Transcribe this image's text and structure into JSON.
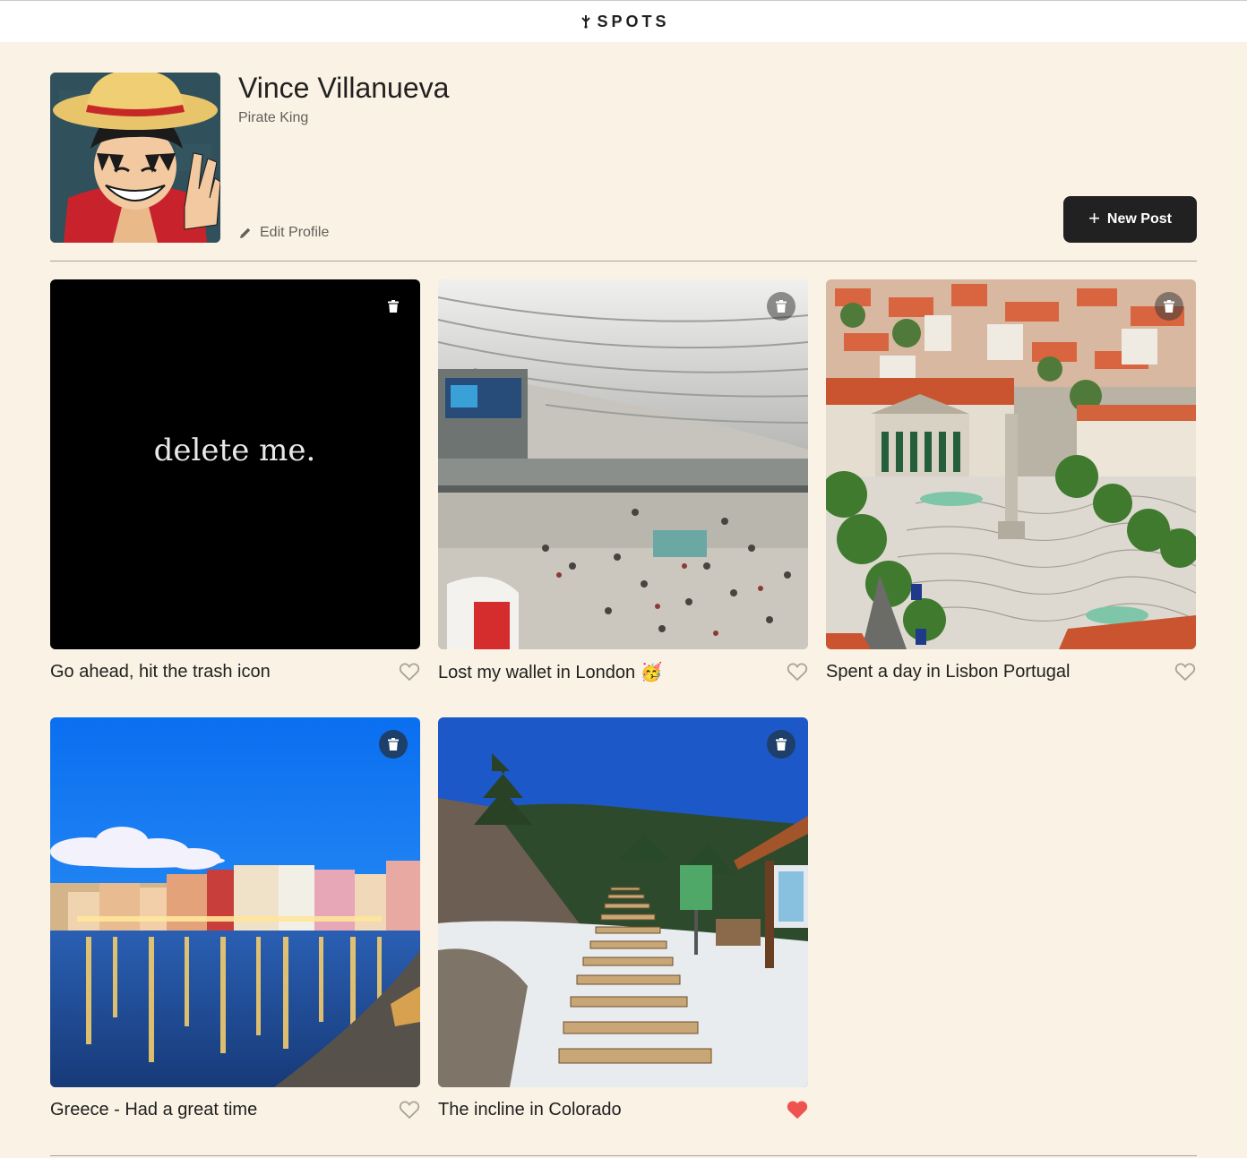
{
  "header": {
    "logo_text": "SPOTS"
  },
  "profile": {
    "name": "Vince Villanueva",
    "description": "Pirate King",
    "edit_label": "Edit Profile",
    "new_post_label": "New Post"
  },
  "cards": [
    {
      "title": "Go ahead, hit the trash icon",
      "image_text": "delete me.",
      "liked": false
    },
    {
      "title": "Lost my wallet in London 🥳",
      "liked": false
    },
    {
      "title": "Spent a day in Lisbon Portugal",
      "liked": false
    },
    {
      "title": "Greece - Had a great time",
      "liked": false
    },
    {
      "title": "The incline in Colorado",
      "liked": true
    }
  ],
  "colors": {
    "page_bg": "#faf2e4",
    "text": "#212121",
    "button_bg": "#212121",
    "heart_liked": "#ef5350",
    "heart_outline": "#a7a29a"
  }
}
